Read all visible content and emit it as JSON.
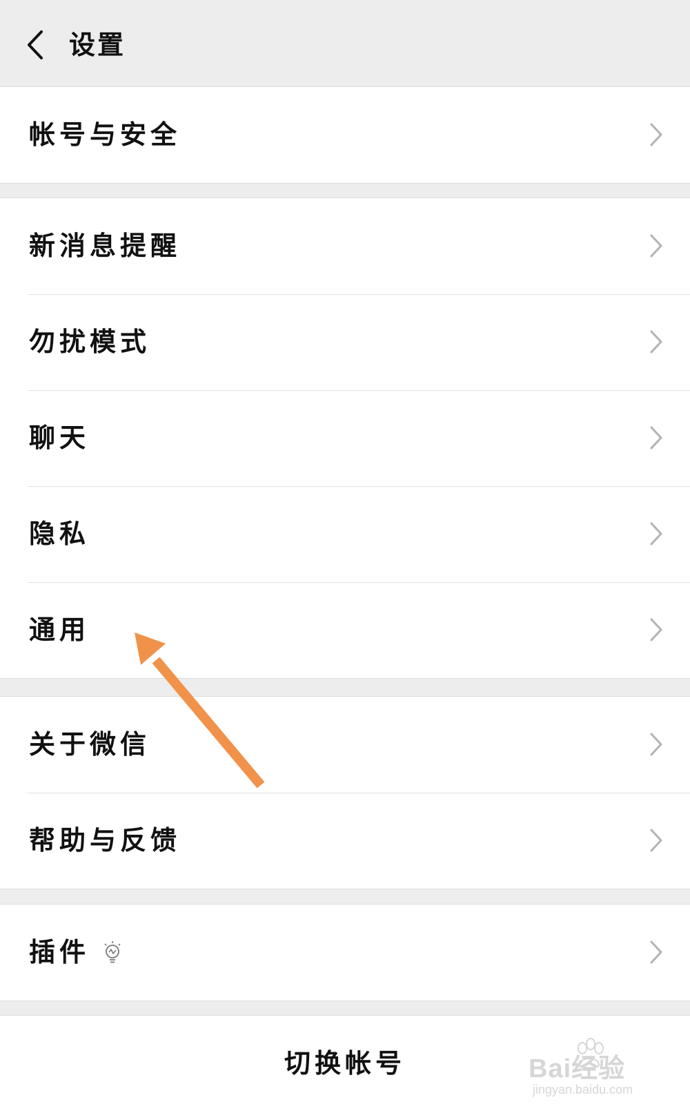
{
  "header": {
    "title": "设置",
    "back_icon": "chevron-left-icon"
  },
  "groups": [
    {
      "items": [
        {
          "label": "帐号与安全",
          "icon": "chevron-right-icon"
        }
      ]
    },
    {
      "items": [
        {
          "label": "新消息提醒",
          "icon": "chevron-right-icon"
        },
        {
          "label": "勿扰模式",
          "icon": "chevron-right-icon"
        },
        {
          "label": "聊天",
          "icon": "chevron-right-icon"
        },
        {
          "label": "隐私",
          "icon": "chevron-right-icon"
        },
        {
          "label": "通用",
          "icon": "chevron-right-icon"
        }
      ]
    },
    {
      "items": [
        {
          "label": "关于微信",
          "icon": "chevron-right-icon"
        },
        {
          "label": "帮助与反馈",
          "icon": "chevron-right-icon"
        }
      ]
    },
    {
      "items": [
        {
          "label": "插件",
          "icon": "chevron-right-icon",
          "badge_icon": "lightbulb-icon"
        }
      ]
    }
  ],
  "footer": {
    "switch_account": "切换帐号"
  },
  "watermark": {
    "main": "Bai经验",
    "sub": "jingyan.baidu.com"
  },
  "annotation": {
    "arrow_color": "#f0924a",
    "target": "通用"
  },
  "colors": {
    "background": "#ededed",
    "card": "#ffffff",
    "text": "#111111",
    "chevron": "#b2b2b2"
  }
}
